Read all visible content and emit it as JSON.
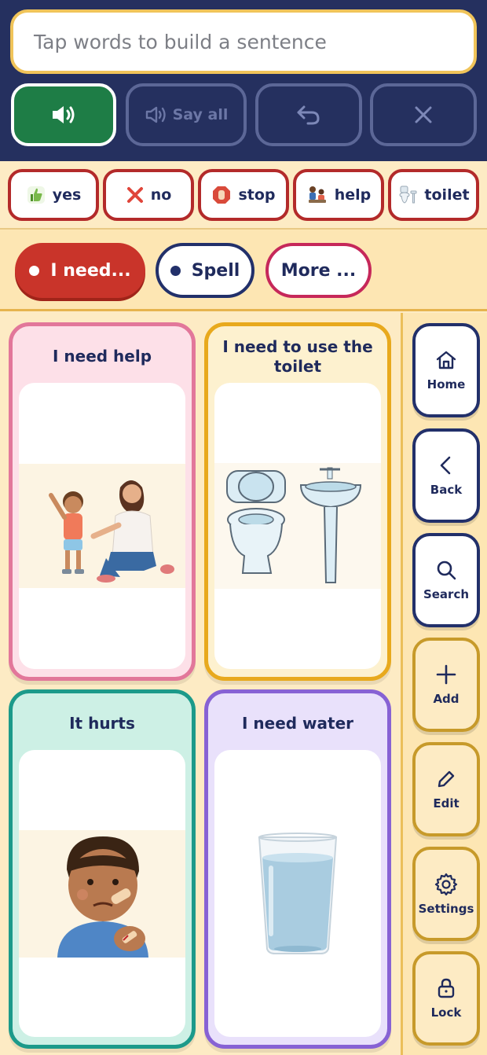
{
  "sentence_bar": {
    "placeholder": "Tap words to build a sentence"
  },
  "controls": {
    "speak_icon": "speaker-icon",
    "say_all_label": "Say all",
    "undo_icon": "undo-icon",
    "clear_icon": "close-icon"
  },
  "quick_words": [
    {
      "label": "yes",
      "icon": "thumbs-up-icon"
    },
    {
      "label": "no",
      "icon": "red-x-icon"
    },
    {
      "label": "stop",
      "icon": "stop-hand-icon"
    },
    {
      "label": "help",
      "icon": "help-people-icon"
    },
    {
      "label": "toilet",
      "icon": "toilet-icon"
    }
  ],
  "modes": [
    {
      "label": "I need...",
      "active": true
    },
    {
      "label": "Spell",
      "active": false
    },
    {
      "label": "More ...",
      "active": false
    }
  ],
  "cards": [
    {
      "label": "I need help",
      "image": "adult-helping-child-illustration"
    },
    {
      "label": "I need to use the toilet",
      "image": "toilet-and-sink-illustration"
    },
    {
      "label": "It hurts",
      "image": "hurt-child-with-bandage-illustration"
    },
    {
      "label": "I need water",
      "image": "glass-of-water-illustration"
    }
  ],
  "side_nav": [
    {
      "label": "Home",
      "icon": "home-icon"
    },
    {
      "label": "Back",
      "icon": "chevron-left-icon"
    },
    {
      "label": "Search",
      "icon": "search-icon"
    },
    {
      "label": "Add",
      "icon": "plus-icon"
    },
    {
      "label": "Edit",
      "icon": "pencil-icon"
    },
    {
      "label": "Settings",
      "icon": "gear-icon"
    },
    {
      "label": "Lock",
      "icon": "lock-icon"
    }
  ],
  "colors": {
    "header_bg": "#25305f",
    "speak_green": "#1e7d46",
    "accent_red": "#c9342a",
    "page_bg": "#fdebc4"
  }
}
